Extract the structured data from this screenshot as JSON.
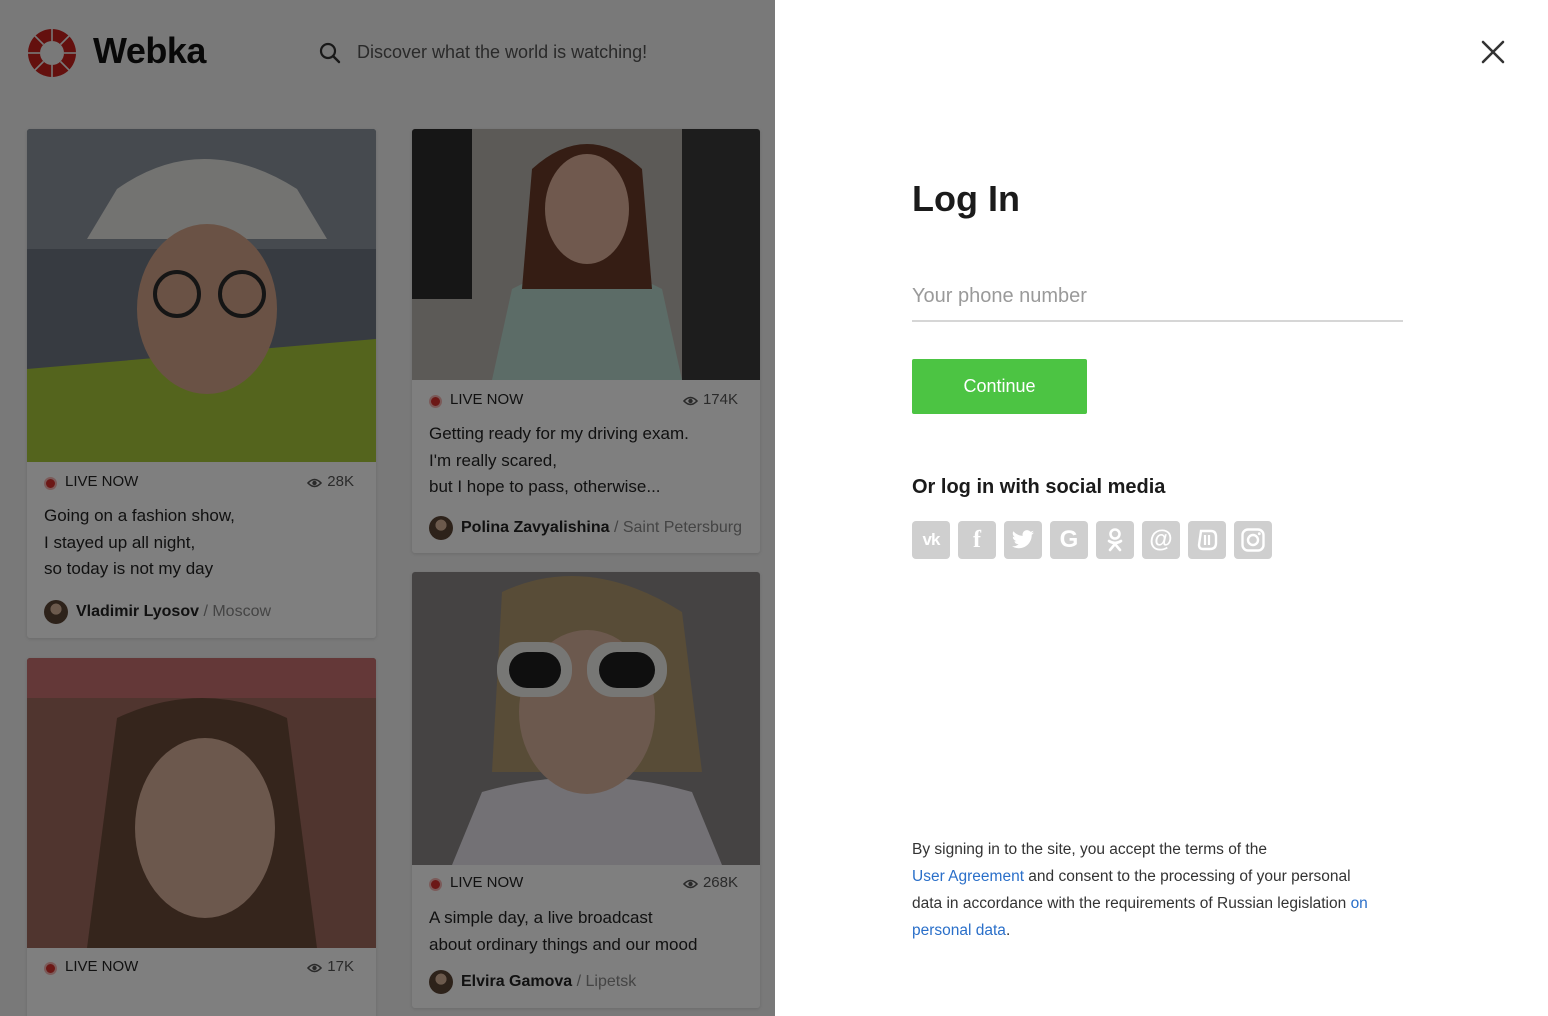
{
  "header": {
    "brand": "Webka",
    "search_placeholder": "Discover what the world is watching!"
  },
  "feed": {
    "cards": [
      {
        "live_label": "LIVE NOW",
        "views": "28K",
        "caption": "Going on a fashion show,\nI stayed up all night,\nso today is not my day",
        "author": "Vladimir Lyosov",
        "city": "/ Moscow"
      },
      {
        "live_label": "LIVE NOW",
        "views": "174K",
        "caption": "Getting ready for my driving exam.\nI'm really scared,\nbut I hope to pass, otherwise...",
        "author": "Polina Zavyalishina",
        "city": "/ Saint Petersburg"
      },
      {
        "live_label": "LIVE NOW",
        "views": "17K"
      },
      {
        "live_label": "LIVE NOW",
        "views": "268K",
        "caption": "A simple day, a live broadcast\nabout ordinary things and our mood",
        "author": "Elvira Gamova",
        "city": "/ Lipetsk"
      }
    ]
  },
  "login": {
    "title": "Log In",
    "phone_placeholder": "Your phone number",
    "phone_value": "",
    "continue_label": "Continue",
    "social_title": "Or log in with social media",
    "social": [
      {
        "name": "vk",
        "icon": "vk-icon",
        "glyph": "vk"
      },
      {
        "name": "facebook",
        "icon": "facebook-icon",
        "glyph": "f"
      },
      {
        "name": "twitter",
        "icon": "twitter-icon",
        "glyph": ""
      },
      {
        "name": "google",
        "icon": "google-icon",
        "glyph": "G"
      },
      {
        "name": "odnoklassniki",
        "icon": "odnoklassniki-icon",
        "glyph": ""
      },
      {
        "name": "mail",
        "icon": "mail-icon",
        "glyph": "@"
      },
      {
        "name": "livejournal",
        "icon": "livejournal-icon",
        "glyph": ""
      },
      {
        "name": "instagram",
        "icon": "instagram-icon",
        "glyph": ""
      }
    ],
    "terms": {
      "text1": "By signing in to the site, you accept the terms of the",
      "link1": "User Agreement",
      "text2": " and consent to the processing of your personal data in accordance with the requirements of Russian legislation ",
      "link2": "on personal data",
      "text3": "."
    }
  },
  "colors": {
    "accent_green": "#4cc443",
    "link_blue": "#2a6fc9",
    "live_red": "#d9302c"
  }
}
